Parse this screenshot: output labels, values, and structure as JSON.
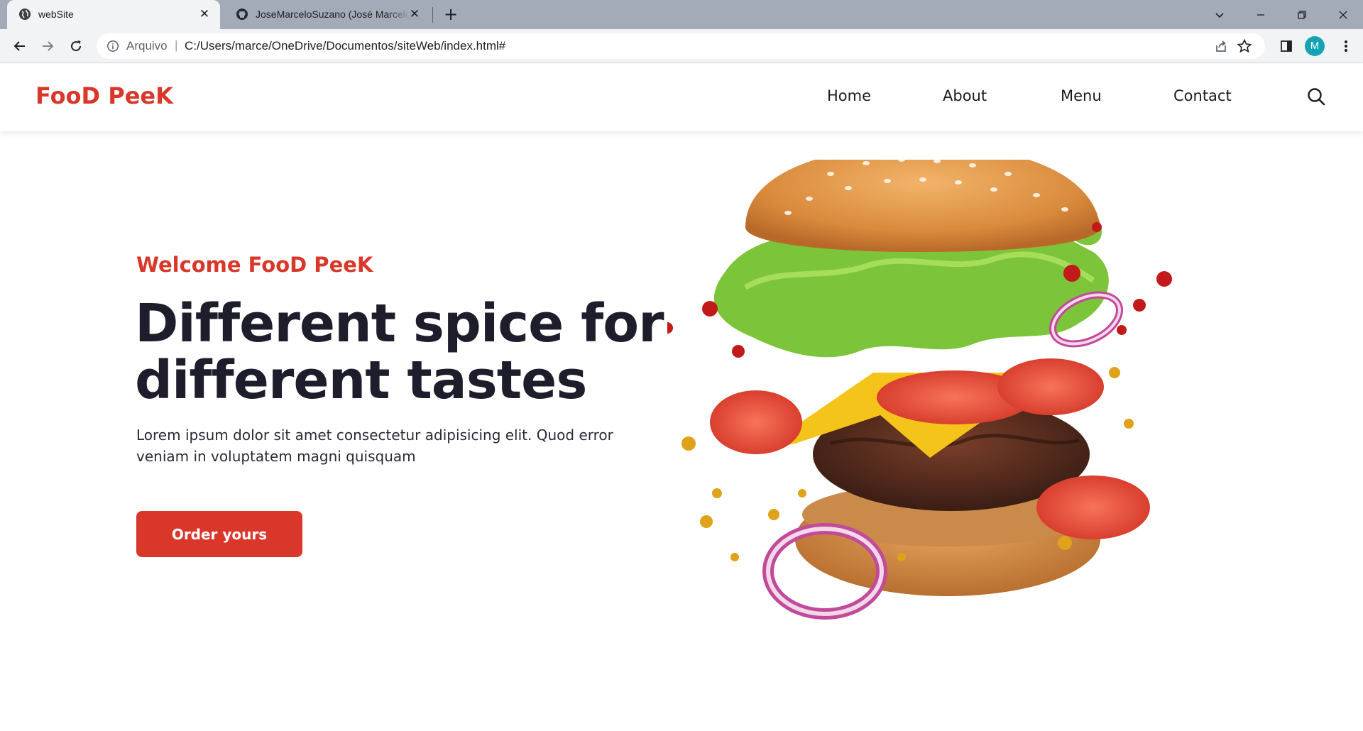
{
  "browser": {
    "tabs": [
      {
        "title": "webSite",
        "active": true
      },
      {
        "title": "JoseMarceloSuzano (José Marcelo Suzano)",
        "active": false
      }
    ],
    "address_bar": {
      "scheme_label": "Arquivo",
      "separator": "|",
      "url": "C:/Users/marce/OneDrive/Documentos/siteWeb/index.html#"
    },
    "profile_initial": "M",
    "profile_color": "#12a4b5"
  },
  "site": {
    "logo": "FooD PeeK",
    "nav": {
      "items": [
        {
          "label": "Home"
        },
        {
          "label": "About"
        },
        {
          "label": "Menu"
        },
        {
          "label": "Contact"
        }
      ]
    },
    "hero": {
      "welcome": "Welcome FooD PeeK",
      "headline_line1": "Different spice for",
      "headline_line2": "different tastes",
      "lead": "Lorem ipsum dolor sit amet consectetur adipisicing elit. Quod error veniam in voluptatem magni quisquam",
      "cta_label": "Order yours"
    },
    "colors": {
      "accent": "#d8372a",
      "heading": "#1e1d2b"
    }
  }
}
